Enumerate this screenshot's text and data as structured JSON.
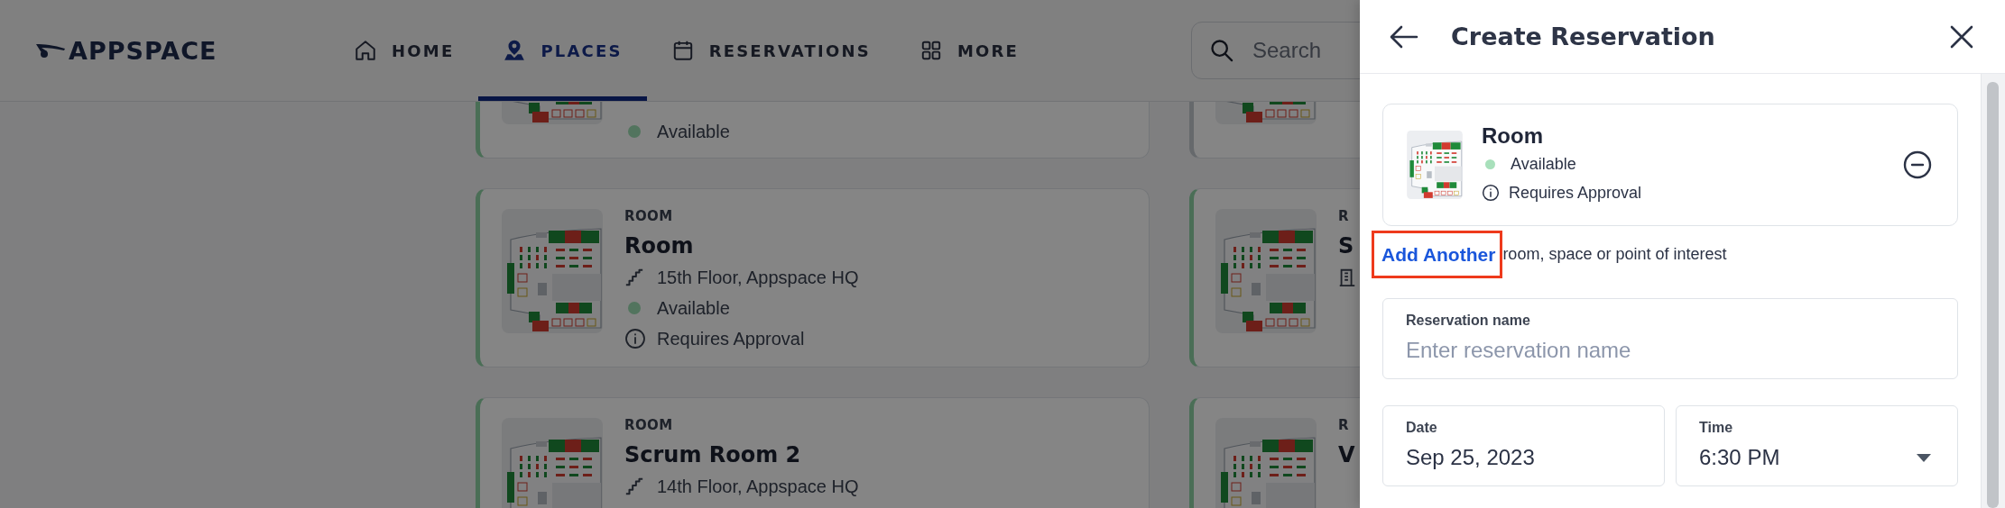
{
  "header": {
    "logo": "APPSPACE",
    "nav": [
      {
        "label": "HOME",
        "selected": false
      },
      {
        "label": "PLACES",
        "selected": true
      },
      {
        "label": "RESERVATIONS",
        "selected": false
      },
      {
        "label": "MORE",
        "selected": false
      }
    ],
    "search": {
      "placeholder": "Search"
    }
  },
  "places": {
    "columns": [
      {
        "cards": [
          {
            "kind": "plain",
            "available": true,
            "status": "Available"
          },
          {
            "kind": "floor",
            "available": true,
            "category": "ROOM",
            "name": "Room",
            "location": "15th Floor, Appspace HQ",
            "status": "Available",
            "note": "Requires Approval"
          },
          {
            "kind": "floor",
            "available": true,
            "category": "ROOM",
            "name": "Scrum Room 2",
            "location": "14th Floor, Appspace HQ"
          }
        ]
      },
      {
        "cards": [
          {
            "kind": "plain",
            "available": false
          },
          {
            "kind": "building",
            "available": true,
            "category": "R",
            "name": "S"
          },
          {
            "kind": "plain",
            "available": true,
            "category": "R",
            "name": "V"
          }
        ]
      }
    ]
  },
  "panel": {
    "title": "Create Reservation",
    "selected_places": [
      {
        "name": "Room",
        "status": "Available",
        "note": "Requires Approval"
      }
    ],
    "add_another": {
      "link": "Add Another",
      "text": "room, space or point of interest",
      "highlighted": true
    },
    "fields": [
      {
        "kind": "text",
        "label": "Reservation name",
        "placeholder": "Enter reservation name"
      },
      {
        "kind": "date",
        "label": "Date",
        "value": "Sep 25, 2023"
      },
      {
        "kind": "select",
        "label": "Time",
        "value": "6:30 PM"
      }
    ]
  }
}
